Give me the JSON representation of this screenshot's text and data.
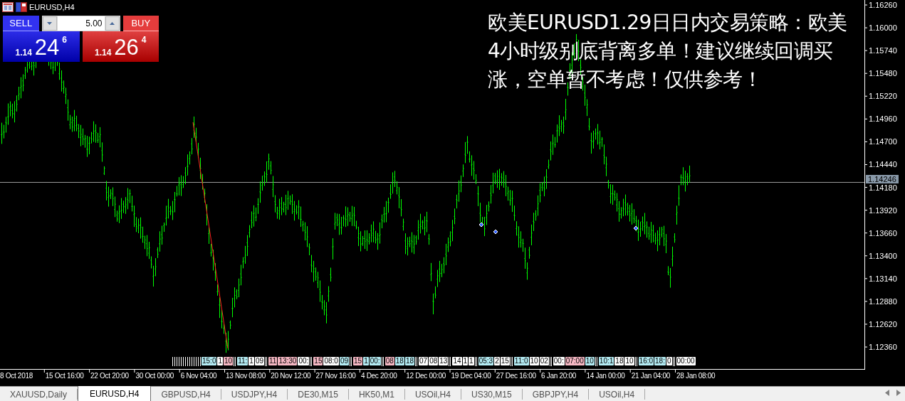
{
  "chart": {
    "title": "EURUSD,H4",
    "trade_panel": {
      "sell_label": "SELL",
      "buy_label": "BUY",
      "lots": "5.00",
      "sell_price": {
        "prefix": "1.14",
        "big": "24",
        "sup": "6"
      },
      "buy_price": {
        "prefix": "1.14",
        "big": "26",
        "sup": "4"
      }
    },
    "overlay_text": [
      "欧美EURUSD1.29日日内交易策略：欧美",
      "4小时级别底背离多单！建议继续回调买",
      "涨，空单暂不考虑！仅供参考！"
    ],
    "price_axis": [
      "1.16260",
      "1.16000",
      "1.15740",
      "1.15480",
      "1.15220",
      "1.14960",
      "1.14700",
      "1.14440",
      "1.14180",
      "1.13920",
      "1.13660",
      "1.13400",
      "1.13140",
      "1.12880",
      "1.12620",
      "1.12360"
    ],
    "current_price": "1.14246",
    "time_axis": [
      "8 Oct 2018",
      "15 Oct 16:00",
      "22 Oct 20:00",
      "30 Oct 00:00",
      "6 Nov 04:00",
      "13 Nov 08:00",
      "20 Nov 12:00",
      "27 Nov 16:00",
      "4 Dec 20:00",
      "12 Dec 00:00",
      "19 Dec 04:00",
      "27 Dec 16:00",
      "6 Jan 20:00",
      "14 Jan 00:00",
      "21 Jan 04:00",
      "28 Jan 08:00"
    ],
    "events": [
      {
        "text": "15:0",
        "color": "#b4ecf4"
      },
      {
        "text": "1",
        "color": "#ffffff"
      },
      {
        "text": "10",
        "color": "#f6b8c4"
      },
      {
        "text": "11:",
        "color": "#b4ecf4"
      },
      {
        "text": "1",
        "color": "#ffffff"
      },
      {
        "text": "09",
        "color": "#ffffff"
      },
      {
        "text": "11",
        "color": "#f6b8c4"
      },
      {
        "text": "13:30",
        "color": "#f6b8c4"
      },
      {
        "text": "00:",
        "color": "#ffffff"
      },
      {
        "text": "15",
        "color": "#f6b8c4"
      },
      {
        "text": "08:0",
        "color": "#ffffff"
      },
      {
        "text": "09",
        "color": "#b4ecf4"
      },
      {
        "text": "15",
        "color": "#f6b8c4"
      },
      {
        "text": "1",
        "color": "#b4ecf4"
      },
      {
        "text": "00:",
        "color": "#b4ecf4"
      },
      {
        "text": "08",
        "color": "#f6b8c4"
      },
      {
        "text": "18",
        "color": "#b4ecf4"
      },
      {
        "text": "18",
        "color": "#b4ecf4"
      },
      {
        "text": "07",
        "color": "#ffffff"
      },
      {
        "text": "08",
        "color": "#ffffff"
      },
      {
        "text": "13",
        "color": "#ffffff"
      },
      {
        "text": "14",
        "color": "#ffffff"
      },
      {
        "text": "1",
        "color": "#ffffff"
      },
      {
        "text": "1",
        "color": "#ffffff"
      },
      {
        "text": "05:3",
        "color": "#b4ecf4"
      },
      {
        "text": "2",
        "color": "#ffffff"
      },
      {
        "text": "15",
        "color": "#ffffff"
      },
      {
        "text": "11:0",
        "color": "#b4ecf4"
      },
      {
        "text": "10",
        "color": "#ffffff"
      },
      {
        "text": "02",
        "color": "#ffffff"
      },
      {
        "text": "00:",
        "color": "#ffffff"
      },
      {
        "text": "07:00",
        "color": "#f6b8c4"
      },
      {
        "text": "10",
        "color": "#b4ecf4"
      },
      {
        "text": "10:1",
        "color": "#b4ecf4"
      },
      {
        "text": "18",
        "color": "#ffffff"
      },
      {
        "text": "10",
        "color": "#ffffff"
      },
      {
        "text": "16:0",
        "color": "#b4ecf4"
      },
      {
        "text": "18:",
        "color": "#b4ecf4"
      },
      {
        "text": "0",
        "color": "#ffffff"
      },
      {
        "text": "00:00",
        "color": "#ffffff"
      }
    ]
  },
  "tabs": [
    {
      "label": "XAUUSD,Daily",
      "selected": false
    },
    {
      "label": "EURUSD,H4",
      "selected": true
    },
    {
      "label": "GBPUSD,H4",
      "selected": false
    },
    {
      "label": "USDJPY,H4",
      "selected": false
    },
    {
      "label": "DE30,M15",
      "selected": false
    },
    {
      "label": "HK50,M1",
      "selected": false
    },
    {
      "label": "USOil,H4",
      "selected": false
    },
    {
      "label": "US30,M15",
      "selected": false
    },
    {
      "label": "GBPJPY,H4",
      "selected": false
    },
    {
      "label": "USOil,H4",
      "selected": false
    }
  ]
}
